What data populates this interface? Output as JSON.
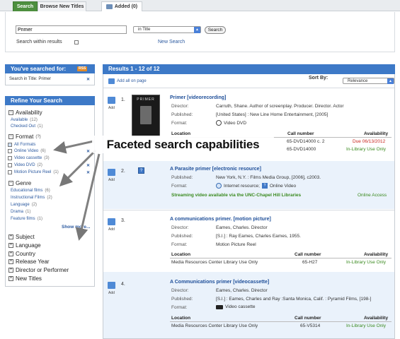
{
  "tabs": {
    "search": "Search",
    "browse": "Browse New Titles",
    "added": "Added (0)"
  },
  "search": {
    "query": "Primer",
    "scope": "in Title",
    "button": "Search",
    "within": "Search within results",
    "newsearch": "New Search"
  },
  "searched": {
    "header": "You've searched for:",
    "rss": "RSS",
    "term": "Search in Title: Primer"
  },
  "refine": {
    "header": "Refine Your Search",
    "availability": {
      "label": "Availability",
      "items": [
        {
          "label": "Available",
          "count": "(12)"
        },
        {
          "label": "Checked Out",
          "count": "(1)"
        }
      ]
    },
    "format": {
      "label": "Format",
      "help": "(?)",
      "items": [
        {
          "label": "All Formats",
          "count": ""
        },
        {
          "label": "Online Video",
          "count": "(6)"
        },
        {
          "label": "Video cassette",
          "count": "(3)"
        },
        {
          "label": "Video DVD",
          "count": "(2)"
        },
        {
          "label": "Motion Picture Reel",
          "count": "(1)"
        }
      ]
    },
    "genre": {
      "label": "Genre",
      "items": [
        {
          "label": "Educational films",
          "count": "(6)"
        },
        {
          "label": "Instructional Films",
          "count": "(2)"
        },
        {
          "label": "Language",
          "count": "(2)"
        },
        {
          "label": "Drama",
          "count": "(1)"
        },
        {
          "label": "Feature films",
          "count": "(1)"
        }
      ]
    },
    "showmore": "Show more...",
    "collapsed": [
      "Subject",
      "Language",
      "Country",
      "Release Year",
      "Director or Performer",
      "New Titles"
    ]
  },
  "results": {
    "header": "Results 1 - 12 of 12",
    "addall": "Add all on page",
    "sortby": "Sort By:",
    "sortval": "Relevance",
    "add": "Add",
    "labels": {
      "director": "Director:",
      "published": "Published:",
      "format": "Format:",
      "location": "Location",
      "call": "Call number",
      "availability": "Availability"
    },
    "items": [
      {
        "num": "1.",
        "title": "Primer [videorecording]",
        "director": "Carruth, Shane. Author of screenplay. Producer. Director. Actor",
        "published": "[United States] : New Line Home Entertainment, [2005]",
        "format": "Video DVD",
        "cover": "PRIMER",
        "rows": [
          {
            "loc": "",
            "call": "65-DVD14000 c. 2",
            "avail": "Due 06/13/2012"
          },
          {
            "loc": "",
            "call": "65-DVD14000",
            "avail": "In-Library Use Only"
          }
        ]
      },
      {
        "num": "2.",
        "title": "A Parasite primer [electronic resource]",
        "published": "New York, N.Y. : Films Media Group, [2006], c2003.",
        "format1": "Internet resource;",
        "format2": "Online Video",
        "streaming": "Streaming video available via the UNC-Chapel Hill Libraries",
        "access": "Online Access"
      },
      {
        "num": "3.",
        "title": "A communications primer. [motion picture]",
        "director": "Eames, Charles. Director",
        "published": "[S.l.] : Ray Eames, Charles Eames, 1955.",
        "format": "Motion Picture Reel",
        "rows": [
          {
            "loc": "Media Resources Center Library Use Only",
            "call": "65-H27",
            "avail": "In-Library Use Only"
          }
        ]
      },
      {
        "num": "4.",
        "title": "A Communications primer [videocassette]",
        "director": "Eames, Charles. Director",
        "published": "[S.l.] : Eames, Charles and Ray :Santa Monica, Calif. : Pyramid Films, [198-]",
        "format": "Video cassette",
        "rows": [
          {
            "loc": "Media Resources Center Library Use Only",
            "call": "65-V5314",
            "avail": "In-Library Use Only"
          }
        ]
      }
    ]
  },
  "callout": "Faceted search capabilities"
}
